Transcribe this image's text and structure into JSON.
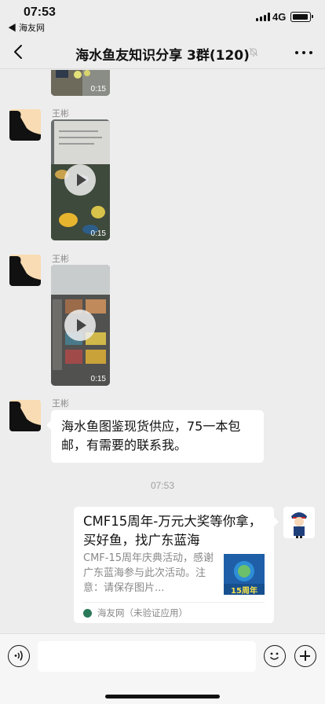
{
  "status_bar": {
    "time": "07:53",
    "back_app": "◀ 海友网",
    "network": "4G"
  },
  "nav": {
    "title": "海水鱼友知识分享 3群(120)"
  },
  "messages": [
    {
      "type": "video",
      "sender": "",
      "duration": "0:15"
    },
    {
      "type": "video",
      "sender": "王彬",
      "duration": "0:15"
    },
    {
      "type": "video",
      "sender": "王彬",
      "duration": "0:15"
    },
    {
      "type": "text",
      "sender": "王彬",
      "text": "海水鱼图鉴现货供应，75一本包邮，有需要的联系我。"
    }
  ],
  "time_separator": "07:53",
  "link_card": {
    "title": "CMF15周年-万元大奖等你拿，买好鱼，找广东蓝海",
    "description": "CMF-15周年庆典活动，感谢广东蓝海参与此次活动。注意：请保存图片...",
    "source": "海友网（未验证应用）",
    "thumb_text": "15周年"
  },
  "colors": {
    "background": "#ededed",
    "bubble": "#ffffff",
    "meta_text": "#8a8a8a"
  },
  "icons": {
    "back": "chevron-left-icon",
    "mute": "bell-slash-icon",
    "more": "ellipsis-icon",
    "play": "play-icon",
    "voice": "voice-icon",
    "emoji": "emoji-icon",
    "plus": "plus-icon"
  }
}
